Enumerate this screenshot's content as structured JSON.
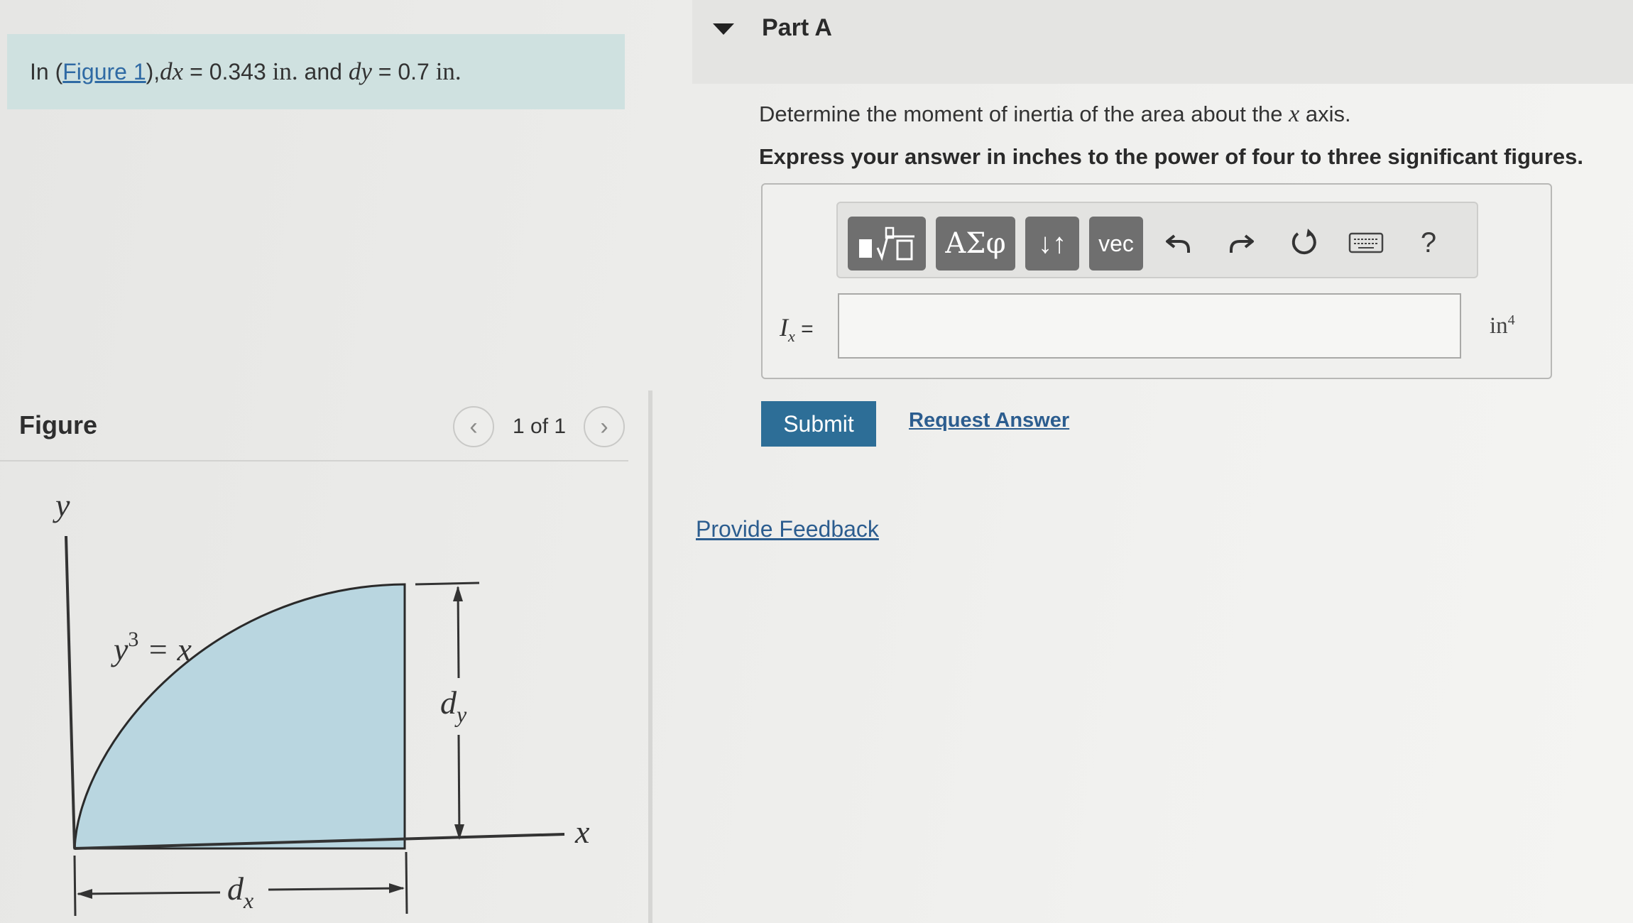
{
  "problem": {
    "prefix": "In (",
    "figure_link": "Figure 1",
    "suffix_open": "), ",
    "dx_symbol": "d",
    "dx_sub": "x",
    "dx_eq": " = 0.343 ",
    "dx_unit": "in.",
    "and": " and ",
    "dy_symbol": "d",
    "dy_sub": "y",
    "dy_eq": " = 0.7 ",
    "dy_unit": "in."
  },
  "figure_panel": {
    "title": "Figure",
    "pager_text": "1 of 1",
    "prev_glyph": "‹",
    "next_glyph": "›"
  },
  "figure": {
    "y_axis_label": "y",
    "x_axis_label": "x",
    "curve_label": "y",
    "curve_label_exp": "3",
    "curve_label_rest": " = x",
    "dy_label": "d",
    "dy_label_sub": "y",
    "dx_label": "d",
    "dx_label_sub": "x",
    "fill_color": "#b9d6e0"
  },
  "part": {
    "title": "Part A",
    "question_prefix": "Determine the moment of inertia of the area about the ",
    "question_math": "x",
    "question_suffix": " axis.",
    "instruction": "Express your answer in inches to the power of four to three significant figures."
  },
  "toolbar": {
    "templates_icon": "templates-sqrt-icon",
    "greek_label": "ΑΣφ",
    "arrows_label": "↓↑",
    "vec_label": "vec",
    "undo_icon": "undo-icon",
    "redo_icon": "redo-icon",
    "reset_icon": "reset-icon",
    "keyboard_icon": "keyboard-icon",
    "help_label": "?"
  },
  "answer": {
    "var_symbol": "I",
    "var_sub": "x",
    "equals": " =",
    "value": "",
    "unit": "in",
    "unit_exp": "4"
  },
  "actions": {
    "submit_label": "Submit",
    "request_answer_label": "Request Answer",
    "feedback_label": "Provide Feedback"
  },
  "colors": {
    "banner_bg": "#cfe1e0",
    "submit_bg": "#2d6e97",
    "link": "#2c5d8f",
    "toolbar_button": "#6f6f6f"
  }
}
